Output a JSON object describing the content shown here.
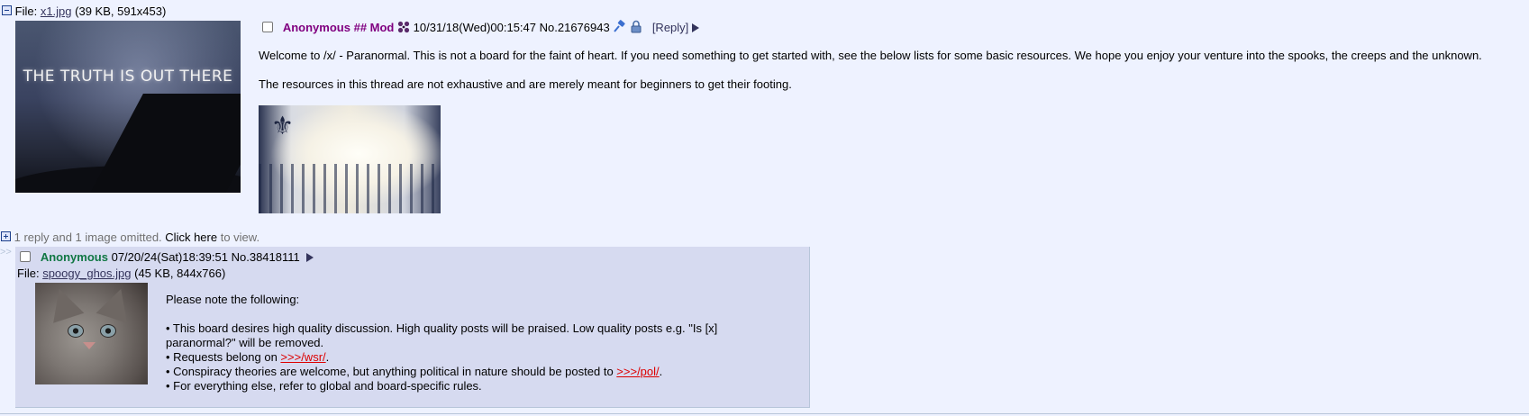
{
  "op": {
    "file_prefix": "File:",
    "file_name": "x1.jpg",
    "file_meta": "(39 KB, 591x453)",
    "thumb_text": "THE TRUTH IS OUT THERE",
    "name": "Anonymous",
    "capcode": "## Mod",
    "datetime": "10/31/18(Wed)00:15:47",
    "post_no": "No.21676943",
    "reply_link": "[Reply]",
    "body": [
      "Welcome to /x/ - Paranormal. This is not a board for the faint of heart. If you need something to get started with, see the below lists for some basic resources. We hope you enjoy your venture into the spooks, the creeps and the unknown.",
      "The resources in this thread are not exhaustive and are merely meant for beginners to get their footing."
    ]
  },
  "omitted": {
    "text": "1 reply and 1 image omitted.",
    "link": "Click here",
    "suffix": "to view."
  },
  "reply": {
    "arrows": ">>",
    "name": "Anonymous",
    "datetime": "07/20/24(Sat)18:39:51",
    "post_no": "No.38418111",
    "file_prefix": "File:",
    "file_name": "spoogy_ghos.jpg",
    "file_meta": "(45 KB, 844x766)",
    "intro": "Please note the following:",
    "bullet1_line1": "• This board desires high quality discussion. High quality posts will be praised. Low quality posts e.g. \"Is [x]",
    "bullet1_line2": "paranormal?\" will be removed.",
    "bullet2_pre": "• Requests belong on ",
    "bullet2_link": ">>>/wsr/",
    "bullet2_post": ".",
    "bullet3_pre": "• Conspiracy theories are welcome, but anything political in nature should be posted to ",
    "bullet3_link": ">>>/pol/",
    "bullet3_post": ".",
    "bullet4": "• For everything else, refer to global and board-specific rules."
  },
  "colors": {
    "background": "#eef2ff",
    "reply_background": "#d6daf0",
    "mod_name": "#800080",
    "name": "#117743",
    "quote_link": "#dd0000"
  }
}
